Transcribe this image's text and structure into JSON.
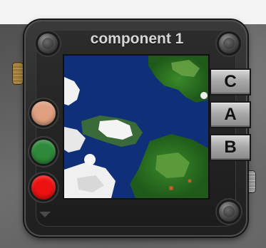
{
  "window": {
    "title": "component 1"
  },
  "color_buttons": [
    {
      "name": "salmon",
      "color": "#e0a080"
    },
    {
      "name": "green",
      "color": "#2e8a3a"
    },
    {
      "name": "red",
      "color": "#ee1111"
    }
  ],
  "letter_buttons": [
    {
      "label": "C"
    },
    {
      "label": "A"
    },
    {
      "label": "B"
    }
  ],
  "icons": {
    "screws": "screw-icon",
    "knobs": "knob-icon",
    "menu": "triangle-down-icon"
  }
}
